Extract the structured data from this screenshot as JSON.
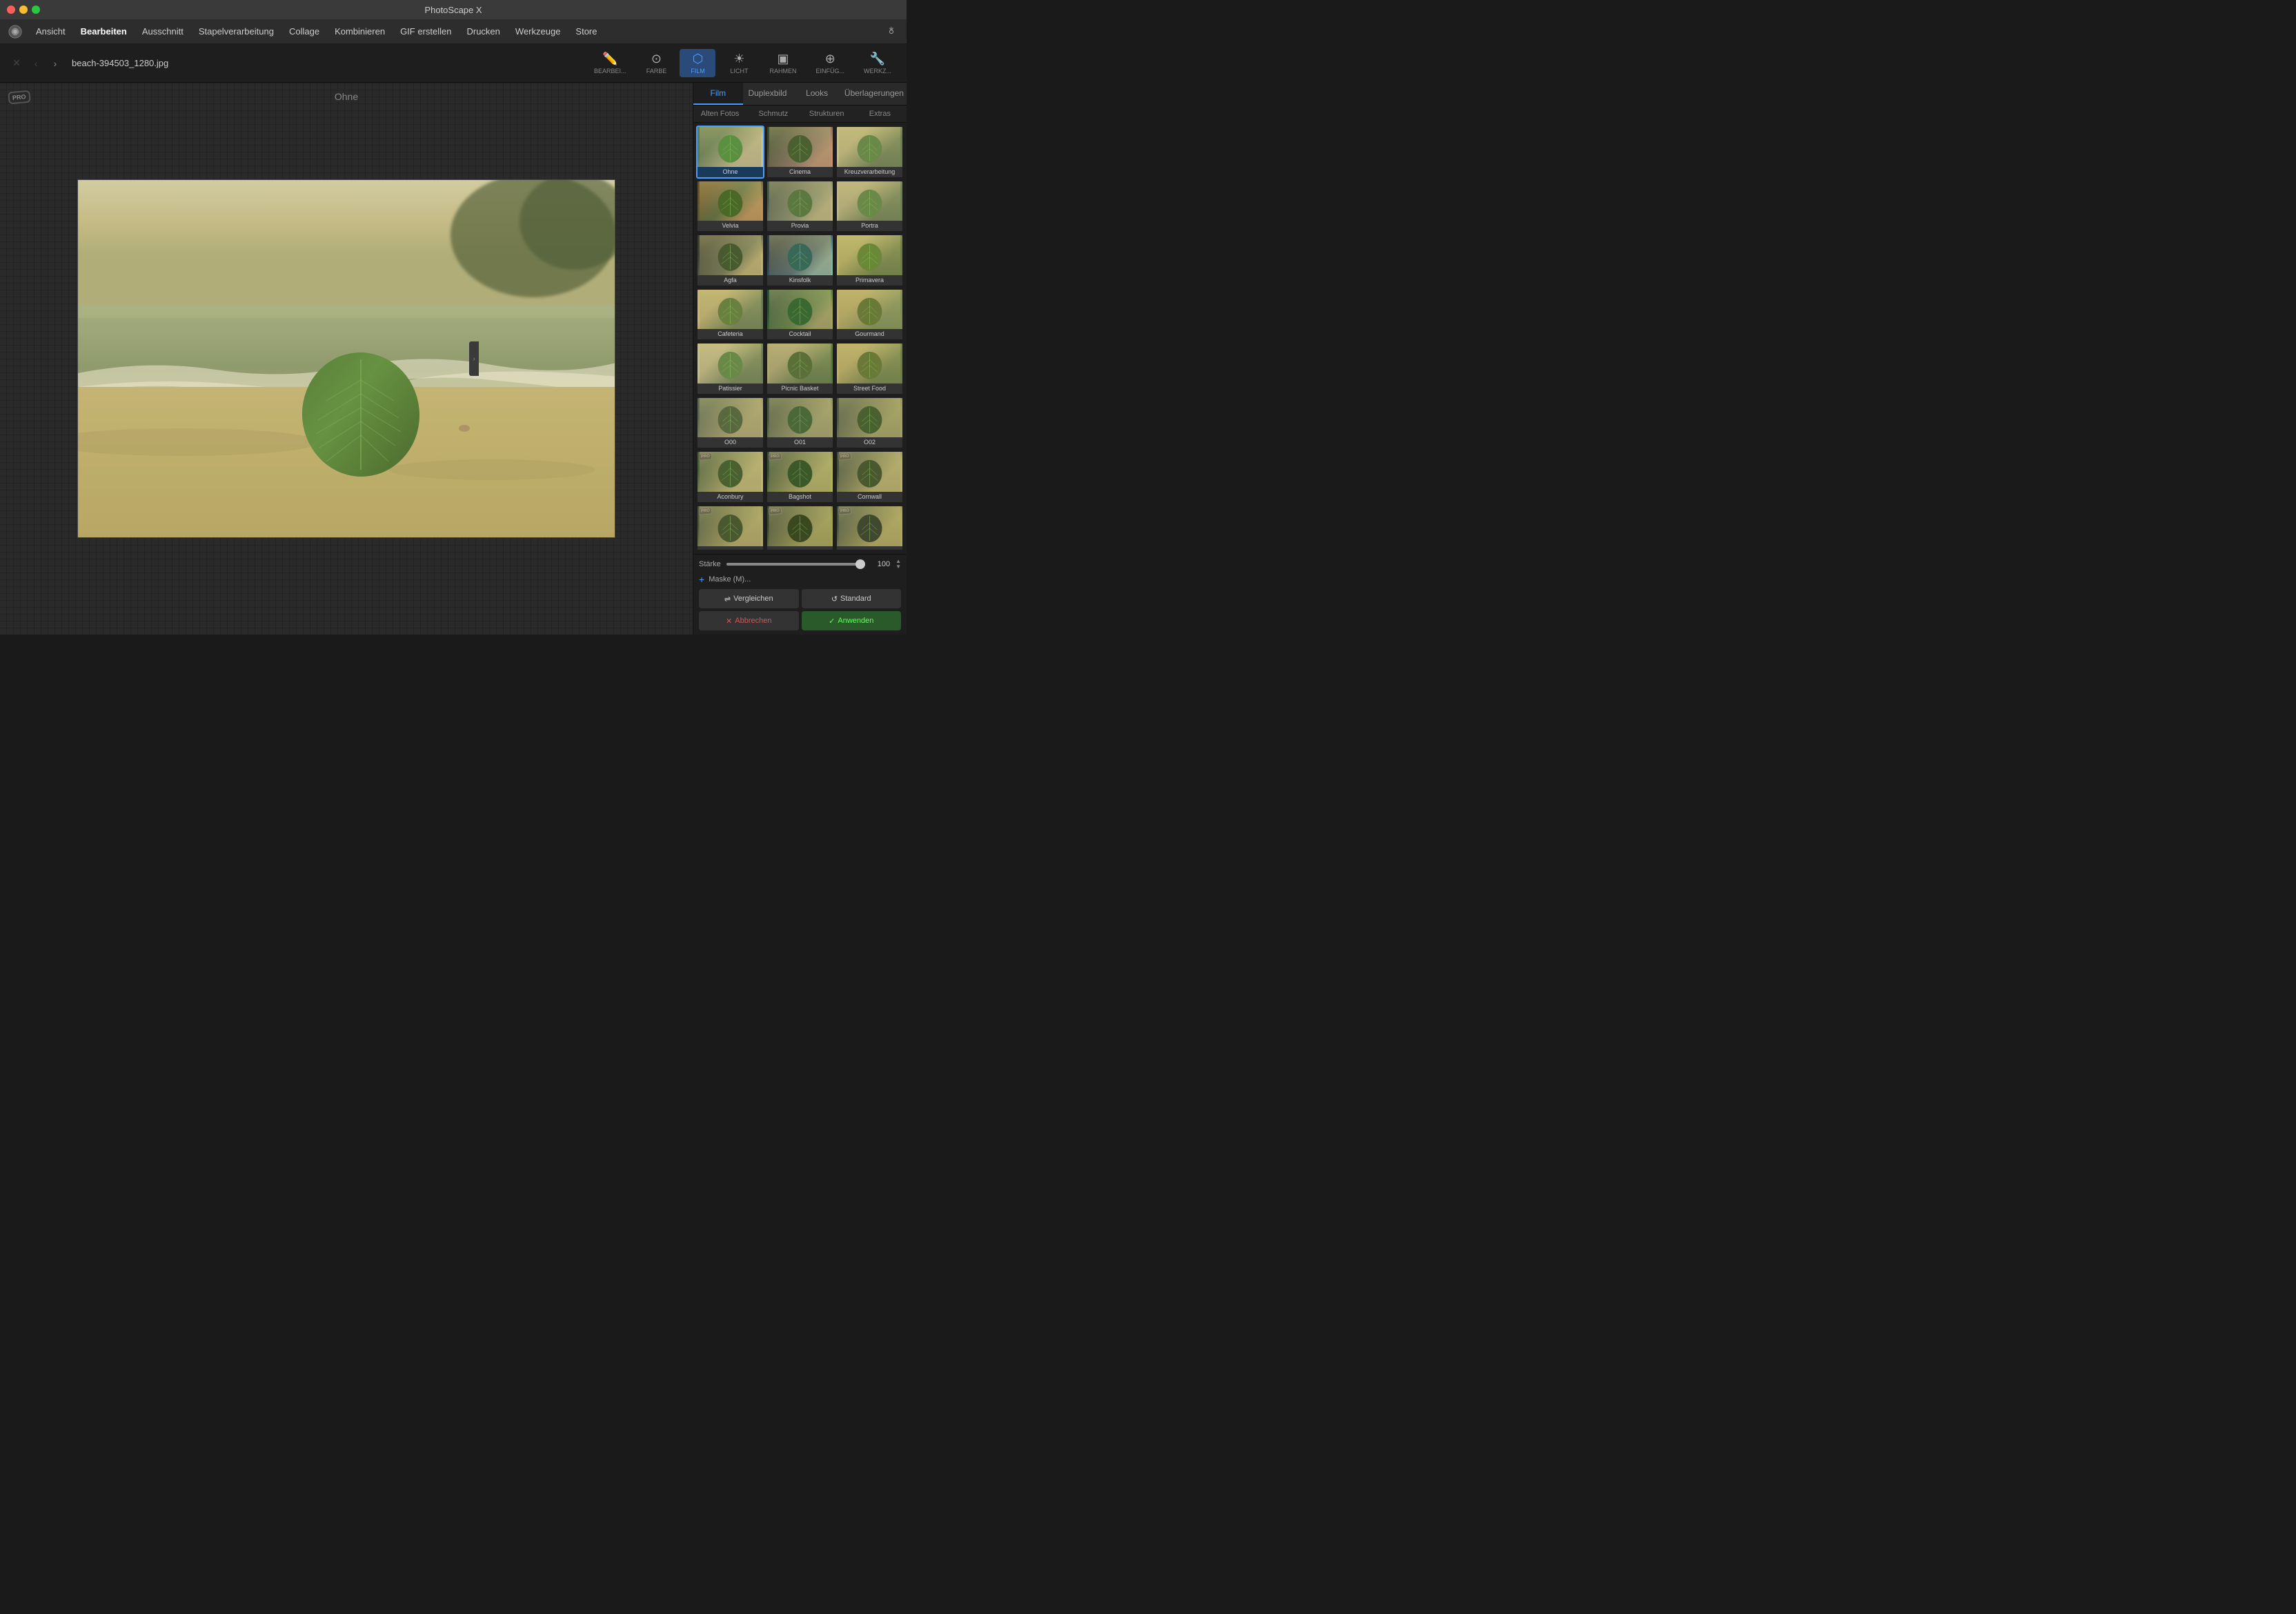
{
  "app": {
    "title": "PhotoScape X",
    "filename": "beach-394503_1280.jpg",
    "filter_label": "Ohne"
  },
  "titlebar": {
    "close": "●",
    "minimize": "●",
    "maximize": "●"
  },
  "menubar": {
    "items": [
      {
        "id": "ansicht",
        "label": "Ansicht",
        "active": false
      },
      {
        "id": "bearbeiten",
        "label": "Bearbeiten",
        "active": true
      },
      {
        "id": "ausschnitt",
        "label": "Ausschnitt",
        "active": false
      },
      {
        "id": "stapel",
        "label": "Stapelverarbeitung",
        "active": false
      },
      {
        "id": "collage",
        "label": "Collage",
        "active": false
      },
      {
        "id": "kombinieren",
        "label": "Kombinieren",
        "active": false
      },
      {
        "id": "gif",
        "label": "GIF erstellen",
        "active": false
      },
      {
        "id": "drucken",
        "label": "Drucken",
        "active": false
      },
      {
        "id": "werkzeuge",
        "label": "Werkzeuge",
        "active": false
      },
      {
        "id": "store",
        "label": "Store",
        "active": false
      }
    ]
  },
  "toolbar": {
    "tools": [
      {
        "id": "bearbeiten",
        "label": "BEARBEI...",
        "active": false
      },
      {
        "id": "farbe",
        "label": "FARBE",
        "active": false
      },
      {
        "id": "film",
        "label": "FILM",
        "active": true
      },
      {
        "id": "licht",
        "label": "LICHT",
        "active": false
      },
      {
        "id": "rahmen",
        "label": "RAHMEN",
        "active": false
      },
      {
        "id": "einfugen",
        "label": "EINFÜG...",
        "active": false
      },
      {
        "id": "werkz",
        "label": "WERKZ...",
        "active": false
      }
    ]
  },
  "right_panel": {
    "tabs1": [
      {
        "id": "film",
        "label": "Film",
        "active": true
      },
      {
        "id": "duplexbild",
        "label": "Duplexbild",
        "active": false
      },
      {
        "id": "looks",
        "label": "Looks",
        "active": false
      },
      {
        "id": "ueberlagerungen",
        "label": "Überlagerungen",
        "active": false
      }
    ],
    "tabs2": [
      {
        "id": "alten",
        "label": "Alten Fotos",
        "active": false
      },
      {
        "id": "schmutz",
        "label": "Schmutz",
        "active": false
      },
      {
        "id": "strukturen",
        "label": "Strukturen",
        "active": false
      },
      {
        "id": "extras",
        "label": "Extras",
        "active": false
      }
    ],
    "filters": [
      {
        "id": "ohne",
        "label": "Ohne",
        "class": "ft-ohne",
        "selected": true,
        "pro": false
      },
      {
        "id": "cinema",
        "label": "Cinema",
        "class": "ft-cinema",
        "selected": false,
        "pro": false
      },
      {
        "id": "kreuz",
        "label": "Kreuzverarbeitung",
        "class": "ft-kreuz",
        "selected": false,
        "pro": false
      },
      {
        "id": "velvia",
        "label": "Velvia",
        "class": "ft-velvia",
        "selected": false,
        "pro": false
      },
      {
        "id": "provia",
        "label": "Provia",
        "class": "ft-provia",
        "selected": false,
        "pro": false
      },
      {
        "id": "portra",
        "label": "Portra",
        "class": "ft-portra",
        "selected": false,
        "pro": false
      },
      {
        "id": "agfa",
        "label": "Agfa",
        "class": "ft-agfa",
        "selected": false,
        "pro": false
      },
      {
        "id": "kinsfolk",
        "label": "Kinsfolk",
        "class": "ft-kinsfolk",
        "selected": false,
        "pro": false
      },
      {
        "id": "primavera",
        "label": "Primavera",
        "class": "ft-primavera",
        "selected": false,
        "pro": false
      },
      {
        "id": "cafeteria",
        "label": "Cafeteria",
        "class": "ft-cafeteria",
        "selected": false,
        "pro": false
      },
      {
        "id": "cocktail",
        "label": "Cocktail",
        "class": "ft-cocktail",
        "selected": false,
        "pro": false
      },
      {
        "id": "gourmand",
        "label": "Gourmand",
        "class": "ft-gourmand",
        "selected": false,
        "pro": false
      },
      {
        "id": "patissier",
        "label": "Patissier",
        "class": "ft-patissier",
        "selected": false,
        "pro": false
      },
      {
        "id": "picnic",
        "label": "Picnic Basket",
        "class": "ft-picnic",
        "selected": false,
        "pro": false
      },
      {
        "id": "street",
        "label": "Street Food",
        "class": "ft-street",
        "selected": false,
        "pro": false
      },
      {
        "id": "o00",
        "label": "O00",
        "class": "ft-o00",
        "selected": false,
        "pro": false
      },
      {
        "id": "o01",
        "label": "O01",
        "class": "ft-o01",
        "selected": false,
        "pro": false
      },
      {
        "id": "o02",
        "label": "O02",
        "class": "ft-o02",
        "selected": false,
        "pro": false
      },
      {
        "id": "aconbury",
        "label": "Aconbury",
        "class": "ft-aconbury",
        "selected": false,
        "pro": true
      },
      {
        "id": "bagshot",
        "label": "Bagshot",
        "class": "ft-bagshot",
        "selected": false,
        "pro": true
      },
      {
        "id": "cornwall",
        "label": "Cornwall",
        "class": "ft-cornwall",
        "selected": false,
        "pro": true
      },
      {
        "id": "more1",
        "label": "",
        "class": "ft-more1",
        "selected": false,
        "pro": true
      },
      {
        "id": "more2",
        "label": "",
        "class": "ft-more2",
        "selected": false,
        "pro": true
      },
      {
        "id": "more3",
        "label": "",
        "class": "ft-more3",
        "selected": false,
        "pro": true
      }
    ],
    "strength": {
      "label": "Stärke",
      "value": 100
    },
    "mask_btn": "Maske (M)...",
    "compare_btn": "Vergleichen",
    "standard_btn": "Standard",
    "cancel_btn": "Abbrechen",
    "apply_btn": "Anwenden"
  }
}
